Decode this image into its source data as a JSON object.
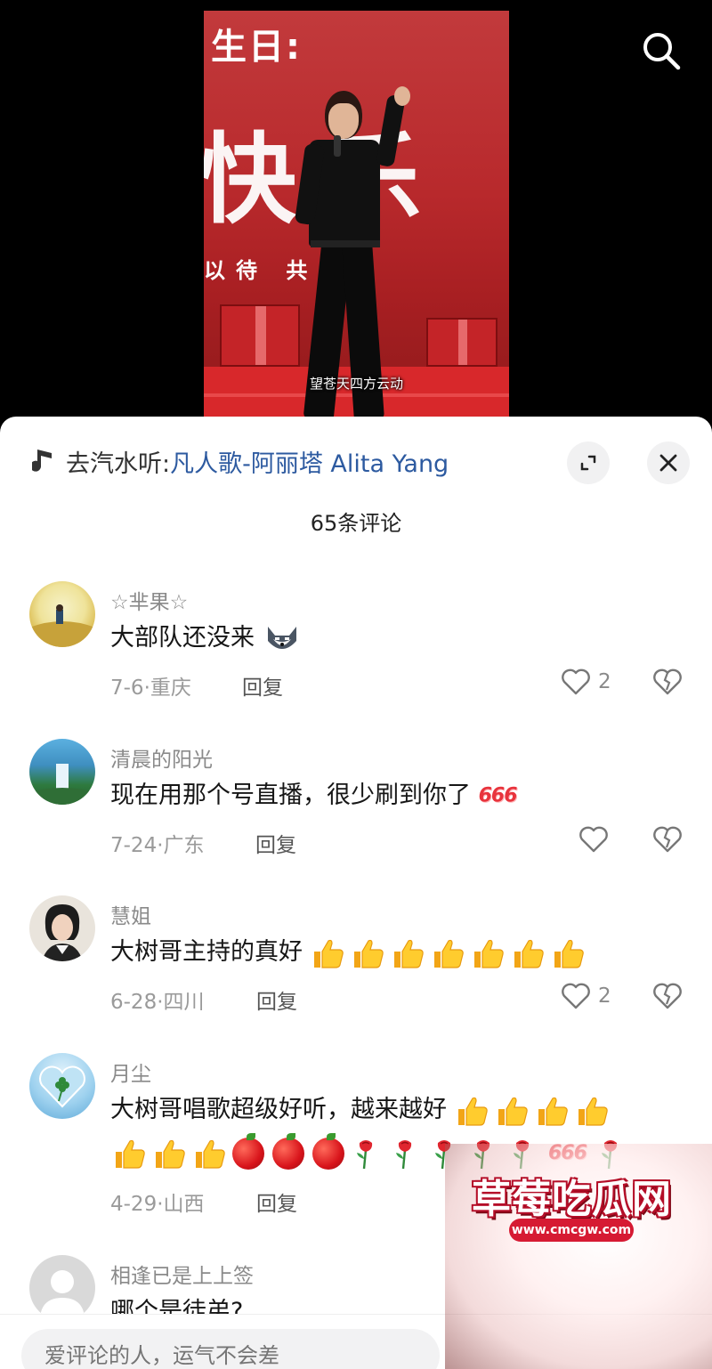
{
  "video": {
    "banner_line1": "生日:",
    "banner_line2": "快乐",
    "banner_line3": "以待 共",
    "subtitle": "望苍天四方云动"
  },
  "sheet": {
    "music_prefix": "去汽水听:",
    "music_link": "凡人歌-阿丽塔 Alita Yang",
    "comment_count": "65条评论"
  },
  "comments": [
    {
      "name": "☆芈果☆",
      "text": "大部队还没来",
      "date": "7-6·",
      "location": "重庆",
      "reply": "回复",
      "likes": "2"
    },
    {
      "name": "清晨的阳光",
      "text": "现在用那个号直播，很少刷到你了",
      "date": "7-24·",
      "location": "广东",
      "reply": "回复",
      "likes": ""
    },
    {
      "name": "慧姐",
      "text": "大树哥主持的真好",
      "date": "6-28·",
      "location": "四川",
      "reply": "回复",
      "likes": "2"
    },
    {
      "name": "月尘",
      "text": "大树哥唱歌超级好听，越来越好",
      "date": "4-29·",
      "location": "山西",
      "reply": "回复",
      "likes": ""
    },
    {
      "name": "相逢已是上上签",
      "text": "哪个是徒弟?",
      "date": "",
      "location": "",
      "reply": "",
      "likes": ""
    }
  ],
  "emoji_666": "666",
  "input": {
    "placeholder": "爱评论的人，运气不会差"
  },
  "watermark": {
    "title": "草莓吃瓜网",
    "url": "www.cmcgw.com"
  },
  "colors": {
    "link": "#2d5aa0",
    "banner_red": "#b8292c",
    "watermark_red": "#d61a33"
  }
}
